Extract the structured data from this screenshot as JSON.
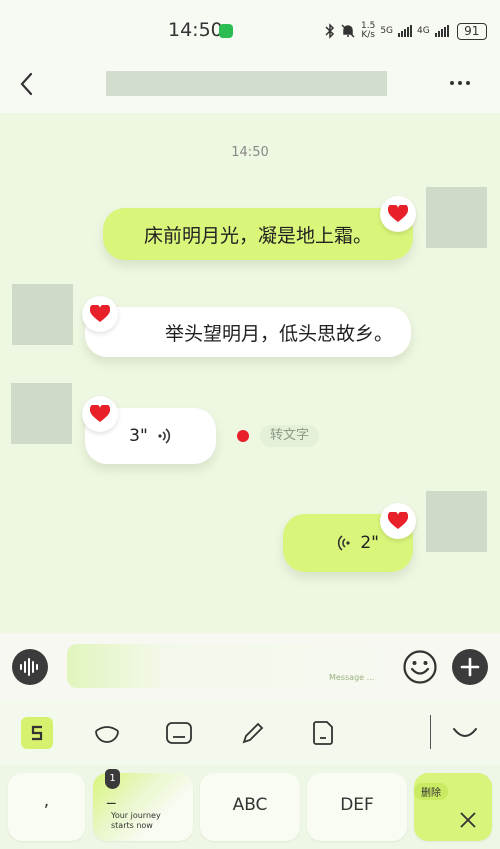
{
  "status_bar": {
    "time": "14:50",
    "net_speed_value": "1.5",
    "net_speed_unit": "K/s",
    "sim1": "5G",
    "sim2": "4G",
    "battery": "91"
  },
  "chat": {
    "timestamp": "14:50",
    "messages": [
      {
        "direction": "sent",
        "type": "text",
        "text": "床前明月光，凝是地上霜。",
        "reaction": "heart"
      },
      {
        "direction": "received",
        "type": "text",
        "text": "举头望明月，低头思故乡。",
        "reaction": "heart"
      },
      {
        "direction": "received",
        "type": "voice",
        "duration": "3\"",
        "action_label": "转文字",
        "reaction": "heart"
      },
      {
        "direction": "sent",
        "type": "voice",
        "duration": "2\"",
        "reaction": "heart"
      }
    ]
  },
  "input_bar": {
    "placeholder": "Message ..."
  },
  "keyboard": {
    "keys": [
      {
        "label": ","
      },
      {
        "label": "_",
        "badge": "1",
        "subtext_line1": "Your journey",
        "subtext_line2": "starts now"
      },
      {
        "label": "ABC"
      },
      {
        "label": "DEF"
      },
      {
        "label": "",
        "badge": "删除"
      }
    ]
  },
  "colors": {
    "sent_bubble": "#d9f57a",
    "received_bubble": "#ffffff",
    "heart": "#e8202a",
    "accent": "#d6f16e"
  }
}
